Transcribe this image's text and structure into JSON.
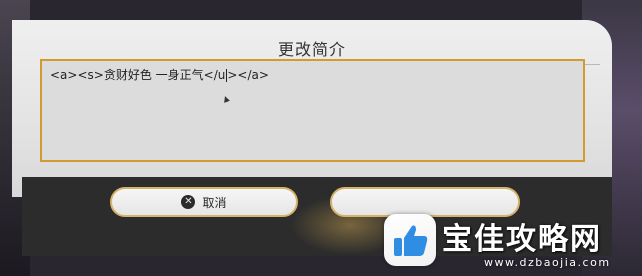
{
  "dialog": {
    "title": "更改简介",
    "bio_input": {
      "value_before_cursor": "<a><s>贪财好色 一身正气</u",
      "value_after_cursor": "></a>"
    },
    "buttons": {
      "cancel_label": "取消",
      "cancel_icon": "close-circle-icon"
    }
  },
  "watermark": {
    "brand": "宝佳攻略网",
    "url": "www.dzbaojia.com",
    "logo_icon": "thumbs-up-icon"
  },
  "colors": {
    "accent_border": "#d49a32",
    "button_border": "#d6b36a",
    "bottom_bar": "#2c2c2c"
  }
}
